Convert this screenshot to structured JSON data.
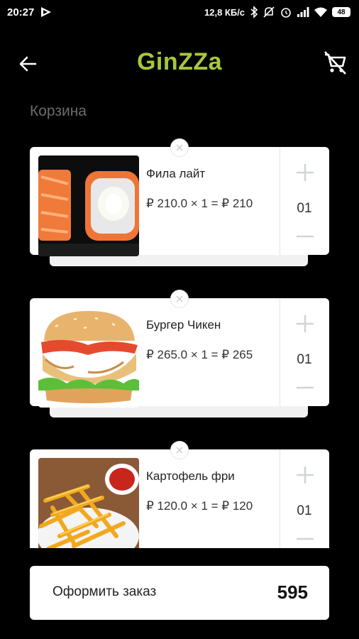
{
  "status_bar": {
    "time": "20:27",
    "net_speed": "12,8 КБ/с",
    "battery": "48"
  },
  "header": {
    "title": "GinZZa",
    "title_color": "#a6c83a"
  },
  "section_title": "Корзина",
  "cart": {
    "items": [
      {
        "name": "Фила лайт",
        "price_line": "₽ 210.0 × 1 = ₽ 210",
        "qty": "01",
        "image": "sushi-roll"
      },
      {
        "name": "Бургер Чикен",
        "price_line": "₽ 265.0 × 1 = ₽ 265",
        "qty": "01",
        "image": "chicken-burger"
      },
      {
        "name": "Картофель фри",
        "price_line": "₽ 120.0 × 1 = ₽ 120",
        "qty": "01",
        "image": "french-fries"
      }
    ]
  },
  "checkout": {
    "label": "Оформить заказ",
    "total": "595"
  }
}
